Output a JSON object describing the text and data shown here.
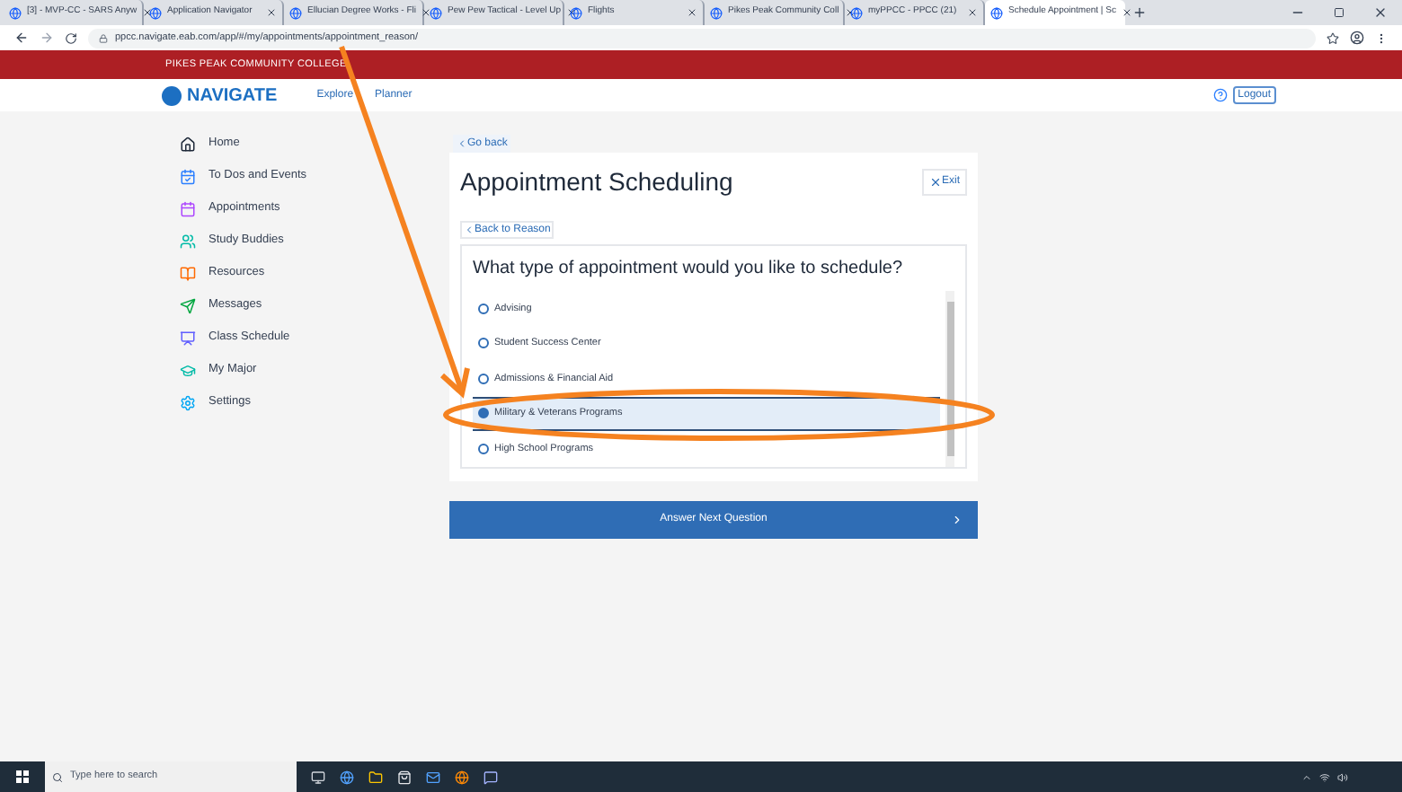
{
  "browser": {
    "tabs": [
      {
        "title": "[3] - MVP-CC - SARS Anyw",
        "selected": false
      },
      {
        "title": "Application Navigator",
        "selected": false
      },
      {
        "title": "Ellucian Degree Works - Fli",
        "selected": false
      },
      {
        "title": "Pew Pew Tactical - Level Up",
        "selected": false
      },
      {
        "title": "Flights",
        "selected": false
      },
      {
        "title": "Pikes Peak Community Coll",
        "selected": false
      },
      {
        "title": "myPPCC - PPCC (21)",
        "selected": false
      },
      {
        "title": "Schedule Appointment | Sc",
        "selected": true
      }
    ],
    "url": "ppcc.navigate.eab.com/app/#/my/appointments/appointment_reason/"
  },
  "banner": {
    "title": "PIKES PEAK COMMUNITY COLLEGE"
  },
  "header": {
    "logo": "NAVIGATE",
    "nav": [
      "Explore",
      "Planner"
    ],
    "logout": "Logout"
  },
  "sidebar": {
    "items": [
      {
        "label": "Home",
        "kind": "home"
      },
      {
        "label": "To Dos and Events",
        "kind": "todo"
      },
      {
        "label": "Appointments",
        "kind": "calendar"
      },
      {
        "label": "Study Buddies",
        "kind": "people"
      },
      {
        "label": "Resources",
        "kind": "book"
      },
      {
        "label": "Messages",
        "kind": "send"
      },
      {
        "label": "Class Schedule",
        "kind": "schedule"
      },
      {
        "label": "My Major",
        "kind": "cap"
      },
      {
        "label": "Settings",
        "kind": "gear"
      }
    ]
  },
  "main": {
    "go_back": "Go back",
    "title": "Appointment Scheduling",
    "exit": "Exit",
    "back_to_reason": "Back to Reason",
    "question": "What type of appointment would you like to schedule?",
    "options": [
      {
        "label": "Advising",
        "selected": false
      },
      {
        "label": "Student Success Center",
        "selected": false
      },
      {
        "label": "Admissions & Financial Aid",
        "selected": false
      },
      {
        "label": "Military & Veterans Programs",
        "selected": true
      },
      {
        "label": "High School Programs",
        "selected": false
      }
    ],
    "next": "Answer Next Question"
  },
  "taskbar": {
    "search_placeholder": "Type here to search"
  }
}
